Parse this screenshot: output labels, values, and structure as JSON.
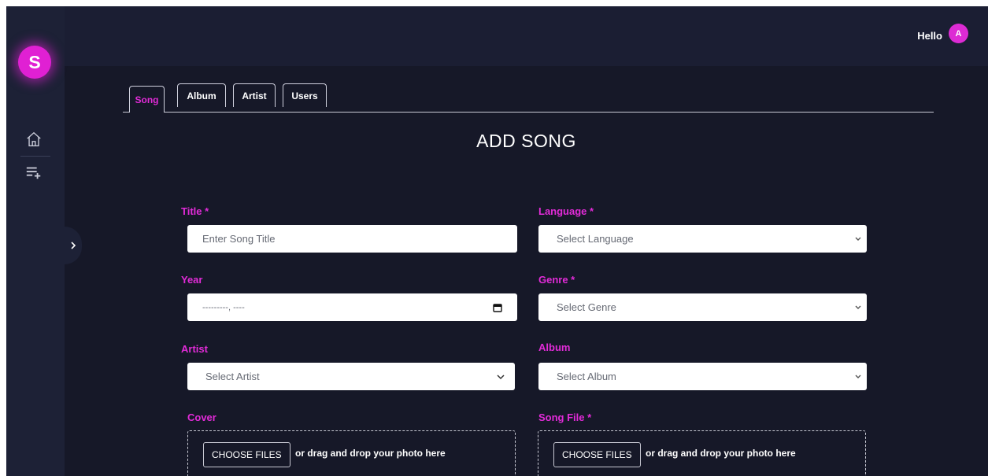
{
  "sidebar": {
    "logo_letter": "S",
    "items": [
      {
        "icon": "home-icon"
      },
      {
        "icon": "add-playlist-icon"
      }
    ],
    "expand_icon": "chevron-right-icon"
  },
  "header": {
    "greeting": "Hello",
    "avatar_letter": "A"
  },
  "tabs": [
    "Song",
    "Album",
    "Artist",
    "Users"
  ],
  "page_title": "ADD SONG",
  "form": {
    "title": {
      "label": "Title *",
      "placeholder": "Enter Song Title"
    },
    "language": {
      "label": "Language *",
      "value": "Select Language"
    },
    "year": {
      "label": "Year",
      "value": "---------, ----"
    },
    "genre": {
      "label": "Genre *",
      "value": "Select Genre"
    },
    "artist": {
      "label": "Artist",
      "value": "Select Artist"
    },
    "album": {
      "label": "Album",
      "value": "Select Album"
    },
    "cover": {
      "label": "Cover",
      "button": "CHOOSE FILES",
      "hint": "or drag and drop your photo here"
    },
    "song_file": {
      "label": "Song File *",
      "button": "CHOOSE FILES",
      "hint": "or drag and drop your photo here"
    }
  },
  "colors": {
    "accent": "#e22bd8",
    "background": "#161828",
    "sidebar": "#1d2136"
  }
}
